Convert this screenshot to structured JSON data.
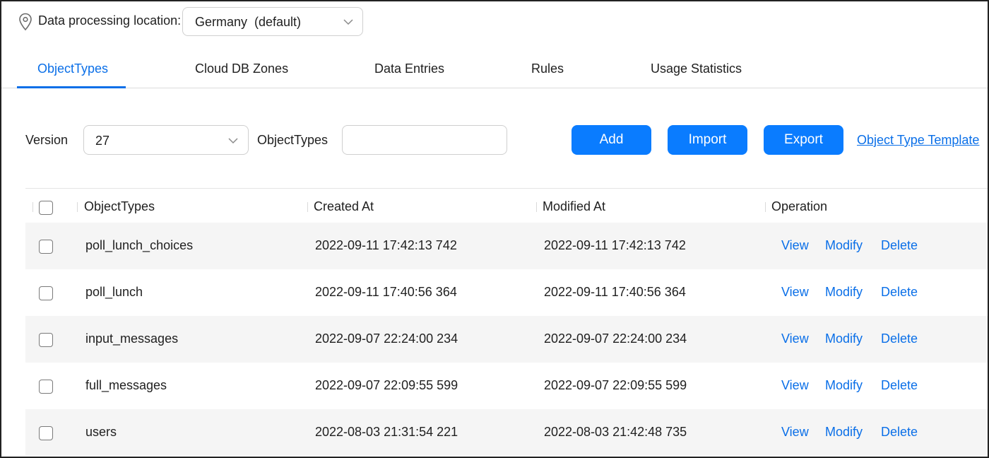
{
  "location": {
    "label": "Data processing location:",
    "selected": "Germany  (default)",
    "icon": "location-pin-icon"
  },
  "tabs": [
    {
      "label": "ObjectTypes",
      "active": true
    },
    {
      "label": "Cloud DB Zones",
      "active": false
    },
    {
      "label": "Data Entries",
      "active": false
    },
    {
      "label": "Rules",
      "active": false
    },
    {
      "label": "Usage Statistics",
      "active": false
    }
  ],
  "filters": {
    "version_label": "Version",
    "version_value": "27",
    "objecttypes_label": "ObjectTypes",
    "objecttypes_value": ""
  },
  "actions": {
    "add": "Add",
    "import": "Import",
    "export": "Export",
    "template_link": "Object Type Template"
  },
  "table": {
    "headers": [
      "ObjectTypes",
      "Created At",
      "Modified At",
      "Operation"
    ],
    "operations": [
      "View",
      "Modify",
      "Delete"
    ],
    "rows": [
      {
        "name": "poll_lunch_choices",
        "created": "2022-09-11 17:42:13 742",
        "modified": "2022-09-11 17:42:13 742"
      },
      {
        "name": "poll_lunch",
        "created": "2022-09-11 17:40:56 364",
        "modified": "2022-09-11 17:40:56 364"
      },
      {
        "name": "input_messages",
        "created": "2022-09-07 22:24:00 234",
        "modified": "2022-09-07 22:24:00 234"
      },
      {
        "name": "full_messages",
        "created": "2022-09-07 22:09:55 599",
        "modified": "2022-09-07 22:09:55 599"
      },
      {
        "name": "users",
        "created": "2022-08-03 21:31:54 221",
        "modified": "2022-08-03 21:42:48 735"
      }
    ]
  },
  "colors": {
    "accent": "#0a7cff",
    "link": "#0a6fe8",
    "row_stripe": "#f5f5f5"
  }
}
